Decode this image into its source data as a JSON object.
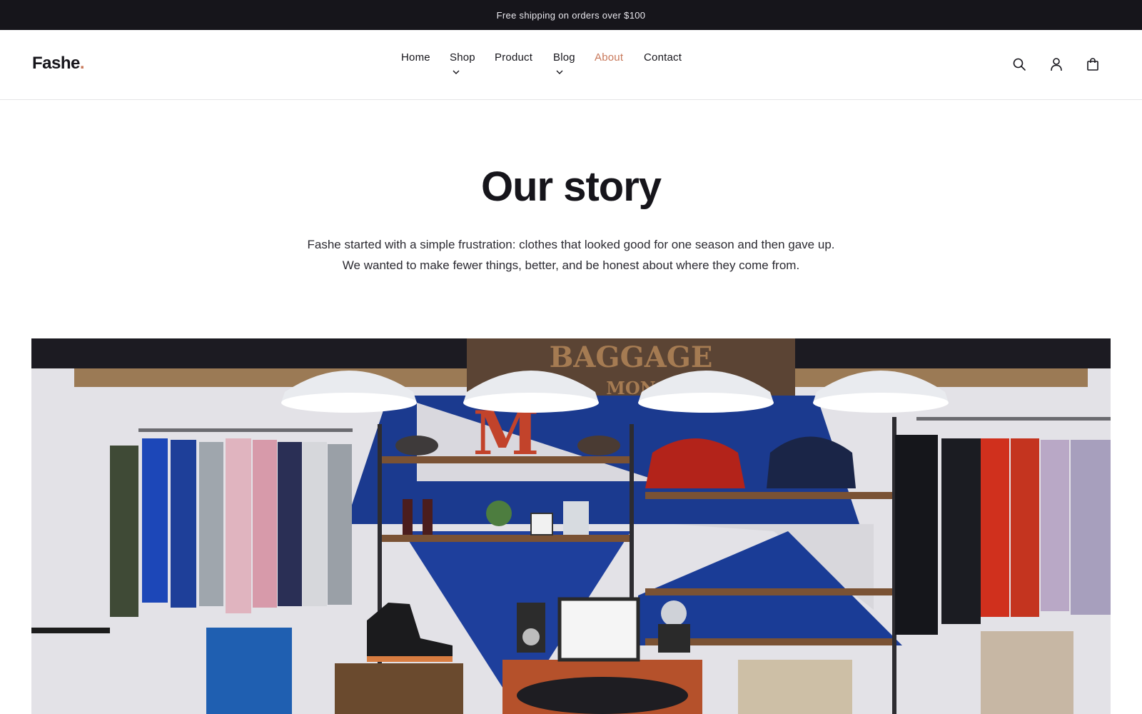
{
  "announcement": {
    "text": "Free shipping on orders over $100"
  },
  "header": {
    "logo_text": "Fashe",
    "logo_dot": ".",
    "nav": [
      {
        "label": "Home",
        "has_dropdown": false,
        "active": false
      },
      {
        "label": "Shop",
        "has_dropdown": true,
        "active": false
      },
      {
        "label": "Product",
        "has_dropdown": false,
        "active": false
      },
      {
        "label": "Blog",
        "has_dropdown": true,
        "active": false
      },
      {
        "label": "About",
        "has_dropdown": false,
        "active": true
      },
      {
        "label": "Contact",
        "has_dropdown": false,
        "active": false
      }
    ],
    "icons": [
      "search-icon",
      "account-icon",
      "shopping-bag-icon"
    ]
  },
  "hero": {
    "title": "Our story",
    "body": "Fashe started with a simple frustration: clothes that looked good for one season and then gave up. We wanted to make fewer things, better, and be honest about where they come from."
  },
  "colors": {
    "accent": "#c8785a",
    "announcement_bg": "#16151b",
    "text": "#16151b"
  }
}
